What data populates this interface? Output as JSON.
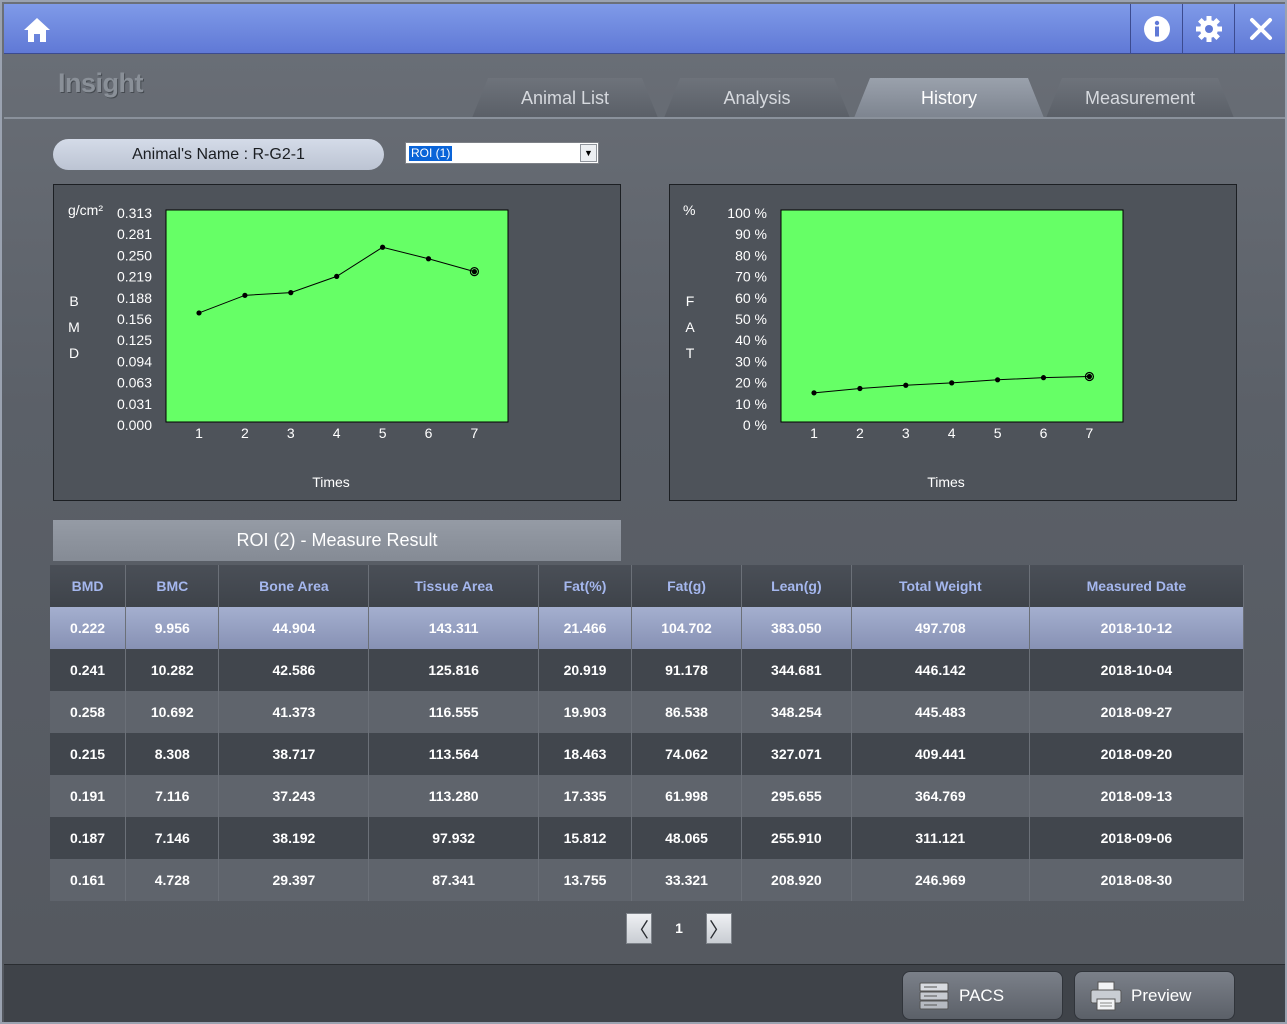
{
  "app": {
    "logo": "Insight",
    "icons": {
      "home": "home-icon",
      "info": "info-icon",
      "settings": "gear-icon",
      "close": "close-icon"
    }
  },
  "tabs": [
    {
      "label": "Animal List",
      "active": false
    },
    {
      "label": "Analysis",
      "active": false
    },
    {
      "label": "History",
      "active": true
    },
    {
      "label": "Measurement",
      "active": false
    }
  ],
  "animal": {
    "name_label": "Animal's Name  : R-G2-1"
  },
  "roi_select": {
    "value": "ROI (1)"
  },
  "charts": {
    "bmd": {
      "y_unit": "g/cm²",
      "y_title_letters": [
        "B",
        "M",
        "D"
      ],
      "y_ticks": [
        "0.313",
        "0.281",
        "0.250",
        "0.219",
        "0.188",
        "0.156",
        "0.125",
        "0.094",
        "0.063",
        "0.031",
        "0.000"
      ],
      "x_ticks": [
        "1",
        "2",
        "3",
        "4",
        "5",
        "6",
        "7"
      ],
      "xlabel": "Times"
    },
    "fat": {
      "y_unit": "%",
      "y_title_letters": [
        "F",
        "A",
        "T"
      ],
      "y_ticks": [
        "100 %",
        "90 %",
        "80 %",
        "70 %",
        "60 %",
        "50 %",
        "40 %",
        "30 %",
        "20 %",
        "10 %",
        "0 %"
      ],
      "x_ticks": [
        "1",
        "2",
        "3",
        "4",
        "5",
        "6",
        "7"
      ],
      "xlabel": "Times"
    }
  },
  "chart_data": [
    {
      "type": "line",
      "x": [
        1,
        2,
        3,
        4,
        5,
        6,
        7
      ],
      "values": [
        0.161,
        0.187,
        0.191,
        0.215,
        0.258,
        0.241,
        0.222
      ],
      "ylim": [
        0.0,
        0.313
      ],
      "xlabel": "Times",
      "ylabel": "BMD",
      "background": "#66ff66",
      "line_color": "#000000",
      "grid": false
    },
    {
      "type": "line",
      "x": [
        1,
        2,
        3,
        4,
        5,
        6,
        7
      ],
      "values": [
        13.755,
        15.812,
        17.335,
        18.463,
        19.903,
        20.919,
        21.466
      ],
      "ylim": [
        0,
        100
      ],
      "xlabel": "Times",
      "ylabel": "FAT",
      "background": "#66ff66",
      "line_color": "#000000",
      "grid": false
    }
  ],
  "result": {
    "title": "ROI (2) - Measure Result",
    "columns": [
      "BMD",
      "BMC",
      "Bone Area",
      "Tissue Area",
      "Fat(%)",
      "Fat(g)",
      "Lean(g)",
      "Total Weight",
      "Measured Date"
    ],
    "rows": [
      [
        "0.222",
        "9.956",
        "44.904",
        "143.311",
        "21.466",
        "104.702",
        "383.050",
        "497.708",
        "2018-10-12"
      ],
      [
        "0.241",
        "10.282",
        "42.586",
        "125.816",
        "20.919",
        "91.178",
        "344.681",
        "446.142",
        "2018-10-04"
      ],
      [
        "0.258",
        "10.692",
        "41.373",
        "116.555",
        "19.903",
        "86.538",
        "348.254",
        "445.483",
        "2018-09-27"
      ],
      [
        "0.215",
        "8.308",
        "38.717",
        "113.564",
        "18.463",
        "74.062",
        "327.071",
        "409.441",
        "2018-09-20"
      ],
      [
        "0.191",
        "7.116",
        "37.243",
        "113.280",
        "17.335",
        "61.998",
        "295.655",
        "364.769",
        "2018-09-13"
      ],
      [
        "0.187",
        "7.146",
        "38.192",
        "97.932",
        "15.812",
        "48.065",
        "255.910",
        "311.121",
        "2018-09-06"
      ],
      [
        "0.161",
        "4.728",
        "29.397",
        "87.341",
        "13.755",
        "33.321",
        "208.920",
        "246.969",
        "2018-08-30"
      ]
    ],
    "selected_row": 0
  },
  "pager": {
    "prev": "〈",
    "page": "1",
    "next": "〉"
  },
  "bottom": {
    "pacs_label": "PACS",
    "preview_label": "Preview"
  },
  "colors": {
    "topbar": "#6d87de",
    "selected_row": "#96a1c3",
    "header_text": "#a5b7ee",
    "plot_bg": "#66ff66"
  }
}
